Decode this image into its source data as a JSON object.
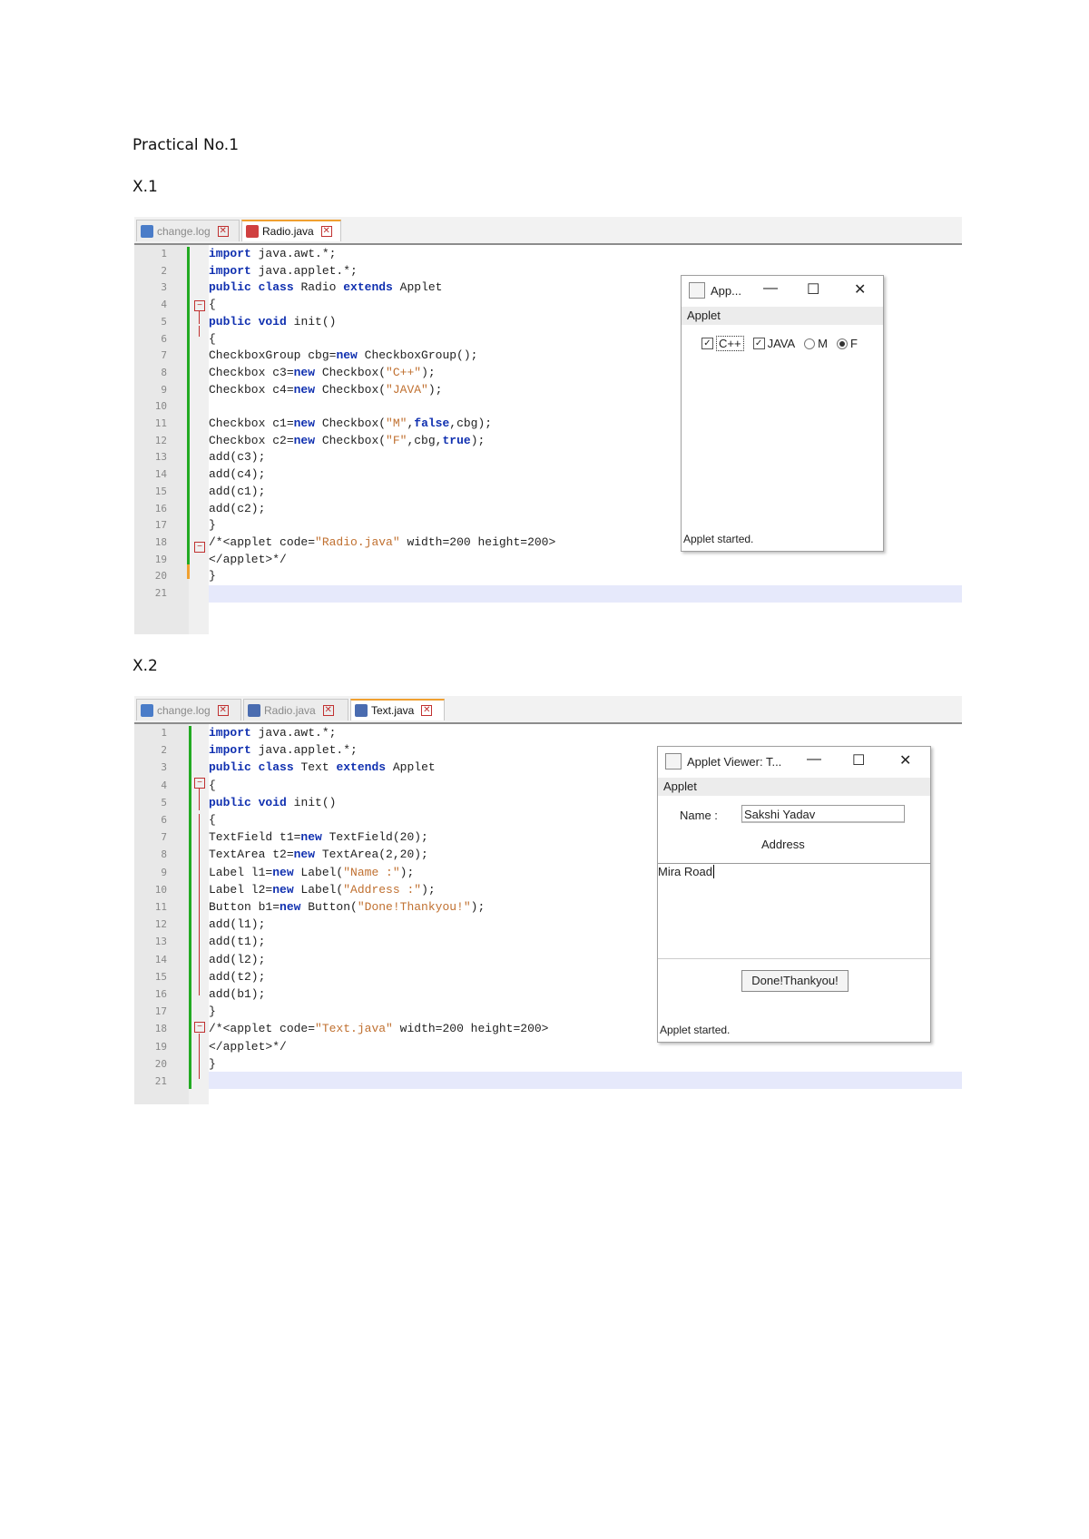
{
  "doc": {
    "title": "Practical No.1",
    "section1": "X.1",
    "section2": "X.2"
  },
  "ide1": {
    "tabs": [
      {
        "label": "change.log",
        "active": false
      },
      {
        "label": "Radio.java",
        "active": true
      }
    ],
    "line_numbers": [
      "1",
      "2",
      "3",
      "4",
      "5",
      "6",
      "7",
      "8",
      "9",
      "10",
      "11",
      "12",
      "13",
      "14",
      "15",
      "16",
      "17",
      "18",
      "19",
      "20",
      "21"
    ],
    "code": [
      "import java.awt.*;",
      "import java.applet.*;",
      "public class Radio extends Applet",
      "{",
      "public void init()",
      "{",
      "CheckboxGroup cbg=new CheckboxGroup();",
      "Checkbox c3=new Checkbox(\"C++\");",
      "Checkbox c4=new Checkbox(\"JAVA\");",
      "",
      "Checkbox c1=new Checkbox(\"M\",false,cbg);",
      "Checkbox c2=new Checkbox(\"F\",cbg,true);",
      "add(c3);",
      "add(c4);",
      "add(c1);",
      "add(c2);",
      "}",
      "/*<applet code=\"Radio.java\" width=200 height=200>",
      "</applet>*/",
      "}",
      ""
    ]
  },
  "applet1": {
    "title": "App...",
    "menu": "Applet",
    "checkbox1": "C++",
    "checkbox2": "JAVA",
    "radio1": "M",
    "radio2": "F",
    "status": "Applet started."
  },
  "ide2": {
    "tabs": [
      {
        "label": "change.log",
        "active": false
      },
      {
        "label": "Radio.java",
        "active": false
      },
      {
        "label": "Text.java",
        "active": true
      }
    ],
    "line_numbers": [
      "1",
      "2",
      "3",
      "4",
      "5",
      "6",
      "7",
      "8",
      "9",
      "10",
      "11",
      "12",
      "13",
      "14",
      "15",
      "16",
      "17",
      "18",
      "19",
      "20",
      "21"
    ],
    "code": [
      "import java.awt.*;",
      "import java.applet.*;",
      "public class Text extends Applet",
      "{",
      "public void init()",
      "{",
      "TextField t1=new TextField(20);",
      "TextArea t2=new TextArea(2,20);",
      "Label l1=new Label(\"Name :\");",
      "Label l2=new Label(\"Address :\");",
      "Button b1=new Button(\"Done!Thankyou!\");",
      "add(l1);",
      "add(t1);",
      "add(l2);",
      "add(t2);",
      "add(b1);",
      "}",
      "/*<applet code=\"Text.java\" width=200 height=200>",
      "</applet>*/",
      "}",
      ""
    ]
  },
  "applet2": {
    "title": "Applet Viewer: T...",
    "menu": "Applet",
    "name_label": "Name :",
    "name_value": "Sakshi Yadav",
    "address_label": "Address",
    "address_value": "Mira Road",
    "button": "Done!Thankyou!",
    "status": "Applet started."
  },
  "colors": {
    "keyword": "#1030b0",
    "gutter_change": "#22aa22",
    "active_tab_accent": "#f0a030",
    "highlight_line": "#e6e9fb"
  }
}
